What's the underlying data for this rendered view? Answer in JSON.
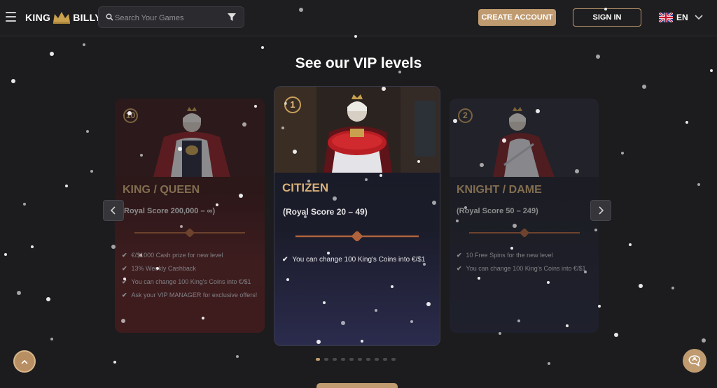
{
  "header": {
    "logo_left": "KING",
    "logo_right": "BILLY",
    "search_placeholder": "Search Your Games",
    "create_account": "CREATE ACCOUNT",
    "sign_in": "SIGN IN",
    "language": "EN",
    "accent_color": "#c09b70"
  },
  "title": "See our VIP levels",
  "cards": [
    {
      "badge": "10",
      "name": "KING / QUEEN",
      "score": "Royal Score 200,000 – ∞)",
      "perks": [
        "€/$1000 Cash prize for new level",
        "13% Weekly Cashback",
        "You can change 100 King's Coins into €/$1",
        "Ask your VIP MANAGER for exclusive offers!"
      ]
    },
    {
      "badge": "1",
      "name": "CITIZEN",
      "score": "(Royal Score 20 – 49)",
      "perks": [
        "You can change 100 King's Coins into €/$1"
      ]
    },
    {
      "badge": "2",
      "name": "KNIGHT / DAME",
      "score": "(Royal Score 50 – 249)",
      "perks": [
        "10 Free Spins for the new level",
        "You can change 100 King's Coins into €/$1"
      ]
    }
  ],
  "carousel": {
    "total_pages": 10,
    "active_page": 1
  },
  "icons": {
    "menu": "hamburger-icon",
    "search": "search-icon",
    "filter": "filter-icon",
    "flag": "uk-flag-icon",
    "dropdown": "chevron-down-icon",
    "prev": "chevron-left-icon",
    "next": "chevron-right-icon",
    "scroll_top": "chevron-up-icon",
    "chat": "chat-icon"
  }
}
